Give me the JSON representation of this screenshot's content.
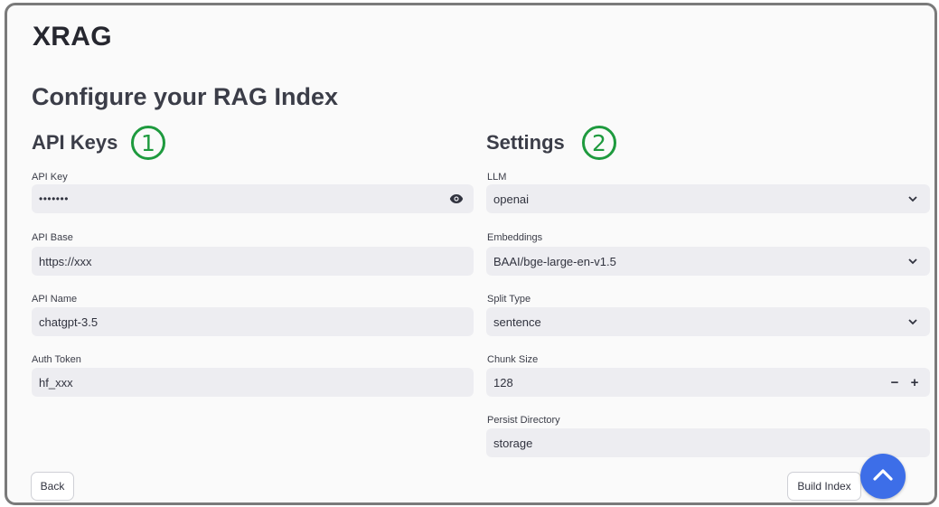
{
  "app": {
    "title": "XRAG"
  },
  "page": {
    "title": "Configure your RAG Index"
  },
  "left": {
    "section_title": "API Keys",
    "badge": "1",
    "fields": [
      {
        "label": "API Key",
        "value": "•••••••",
        "type": "password"
      },
      {
        "label": "API Base",
        "value": "https://xxx"
      },
      {
        "label": "API Name",
        "value": "chatgpt-3.5"
      },
      {
        "label": "Auth Token",
        "value": "hf_xxx"
      }
    ]
  },
  "right": {
    "section_title": "Settings",
    "badge": "2",
    "fields": [
      {
        "label": "LLM",
        "value": "openai",
        "type": "select"
      },
      {
        "label": "Embeddings",
        "value": "BAAI/bge-large-en-v1.5",
        "type": "select"
      },
      {
        "label": "Split Type",
        "value": "sentence",
        "type": "select"
      },
      {
        "label": "Chunk Size",
        "value": "128",
        "type": "number",
        "minus": "−",
        "plus": "+"
      },
      {
        "label": "Persist Directory",
        "value": "storage"
      }
    ]
  },
  "buttons": {
    "back": "Back",
    "build_index": "Build Index"
  },
  "icons": {
    "show_password": "eye-icon",
    "dropdown": "chevron-down-icon",
    "scroll_top": "chevron-up-icon"
  },
  "colors": {
    "badge_green": "#1e9a3e",
    "fab_blue": "#3d6ee8",
    "field_bg": "#ededf1"
  }
}
